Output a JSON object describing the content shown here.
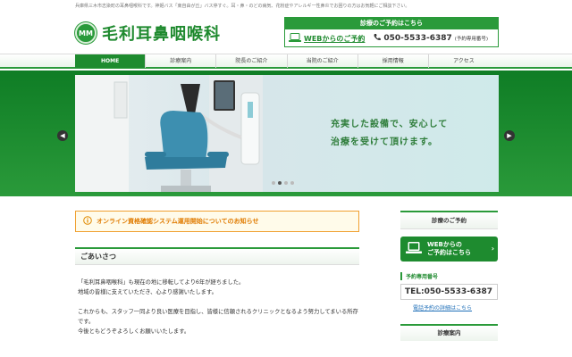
{
  "header": {
    "top_note": "兵庫県三木市志染町の耳鼻咽喉科です。神姫バス「東自由が丘」バス停すぐ。耳・鼻・のどの病気、花粉症やアレルギー性鼻炎でお困りの方はお気軽にご相談下さい。",
    "logo_mark": "MM",
    "logo_text": "毛利耳鼻咽喉科"
  },
  "reservation": {
    "heading": "診療のご予約はこちら",
    "web_label": "WEBからのご予約",
    "tel": "050-5533-6387",
    "tel_note": "(予約専用番号)"
  },
  "nav": {
    "items": [
      {
        "label": "HOME",
        "active": true
      },
      {
        "label": "診療案内"
      },
      {
        "label": "院長のご紹介"
      },
      {
        "label": "当院のご紹介"
      },
      {
        "label": "採用情報"
      },
      {
        "label": "アクセス"
      }
    ]
  },
  "hero": {
    "caption_line1": "充実した設備で、安心して",
    "caption_line2": "治療を受けて頂けます。",
    "prev_icon": "chevron-left-icon",
    "next_icon": "chevron-right-icon",
    "slide_count": 4,
    "active_slide": 2
  },
  "notice": {
    "text": "オンライン資格確認システム運用開始についてのお知らせ"
  },
  "greeting": {
    "title": "ごあいさつ",
    "p1": "「毛利耳鼻咽喉科」も現在の地に移転してより6年が経ちました。\n地域の皆様に支えていただき、心より感謝いたします。",
    "p2": "これからも、スタッフ一同より良い医療を目指し、皆様に信頼されるクリニックとなるよう努力してまいる所存です。\n今後ともどうぞよろしくお願いいたします。"
  },
  "sidebar": {
    "reserve_title": "診療のご予約",
    "web_btn_line1": "WEBからの",
    "web_btn_line2": "ご予約はこちら",
    "tel_label": "予約専用番号",
    "tel": "TEL:050-5533-6387",
    "tel_link": "電話予約の詳細はこちら",
    "guide_title": "診療案内"
  },
  "colors": {
    "brand_green": "#2a9a3a",
    "notice_orange": "#f0a030"
  }
}
